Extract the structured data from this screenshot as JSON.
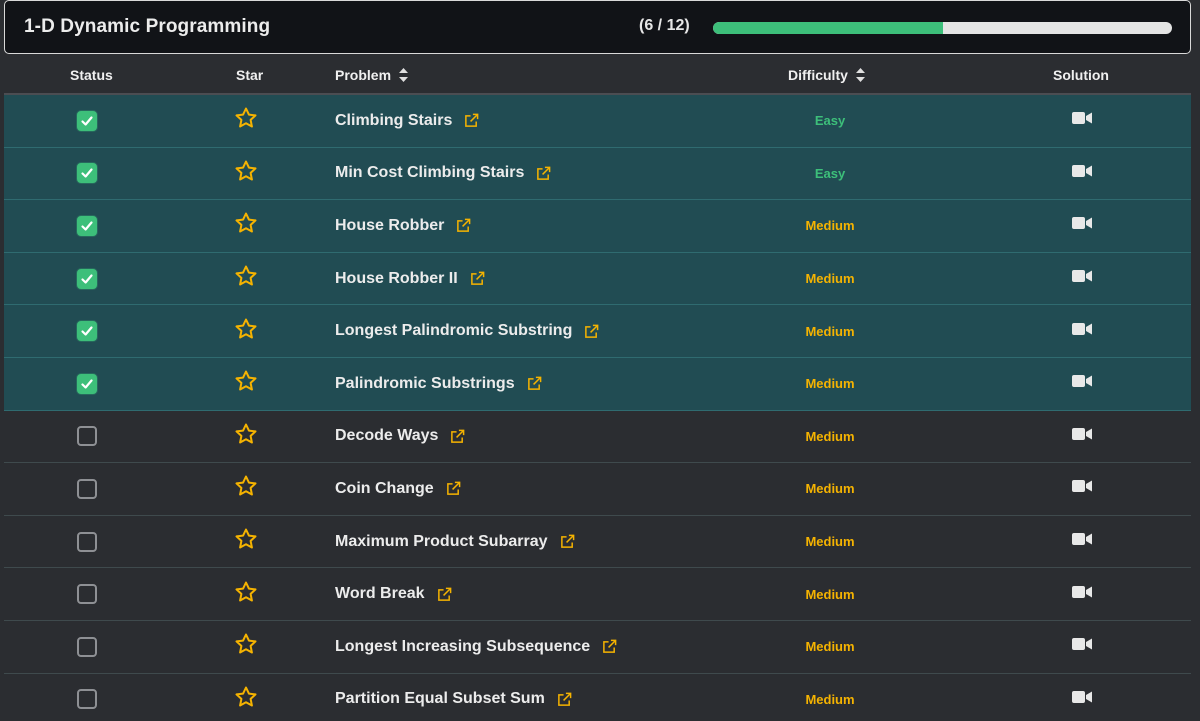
{
  "header": {
    "title": "1-D Dynamic Programming",
    "progress_text": "(6 / 12)",
    "progress_fraction": 0.5,
    "progress_color": "#3dbf7a"
  },
  "columns": {
    "status": "Status",
    "star": "Star",
    "problem": "Problem",
    "difficulty": "Difficulty",
    "solution": "Solution"
  },
  "colors": {
    "easy": "#3dbf7a",
    "medium": "#f5b301",
    "done_row": "#214c53",
    "star": "#f5b301"
  },
  "rows": [
    {
      "problem": "Climbing Stairs",
      "difficulty": "Easy",
      "done": true
    },
    {
      "problem": "Min Cost Climbing Stairs",
      "difficulty": "Easy",
      "done": true
    },
    {
      "problem": "House Robber",
      "difficulty": "Medium",
      "done": true
    },
    {
      "problem": "House Robber II",
      "difficulty": "Medium",
      "done": true
    },
    {
      "problem": "Longest Palindromic Substring",
      "difficulty": "Medium",
      "done": true
    },
    {
      "problem": "Palindromic Substrings",
      "difficulty": "Medium",
      "done": true
    },
    {
      "problem": "Decode Ways",
      "difficulty": "Medium",
      "done": false
    },
    {
      "problem": "Coin Change",
      "difficulty": "Medium",
      "done": false
    },
    {
      "problem": "Maximum Product Subarray",
      "difficulty": "Medium",
      "done": false
    },
    {
      "problem": "Word Break",
      "difficulty": "Medium",
      "done": false
    },
    {
      "problem": "Longest Increasing Subsequence",
      "difficulty": "Medium",
      "done": false
    },
    {
      "problem": "Partition Equal Subset Sum",
      "difficulty": "Medium",
      "done": false
    }
  ]
}
